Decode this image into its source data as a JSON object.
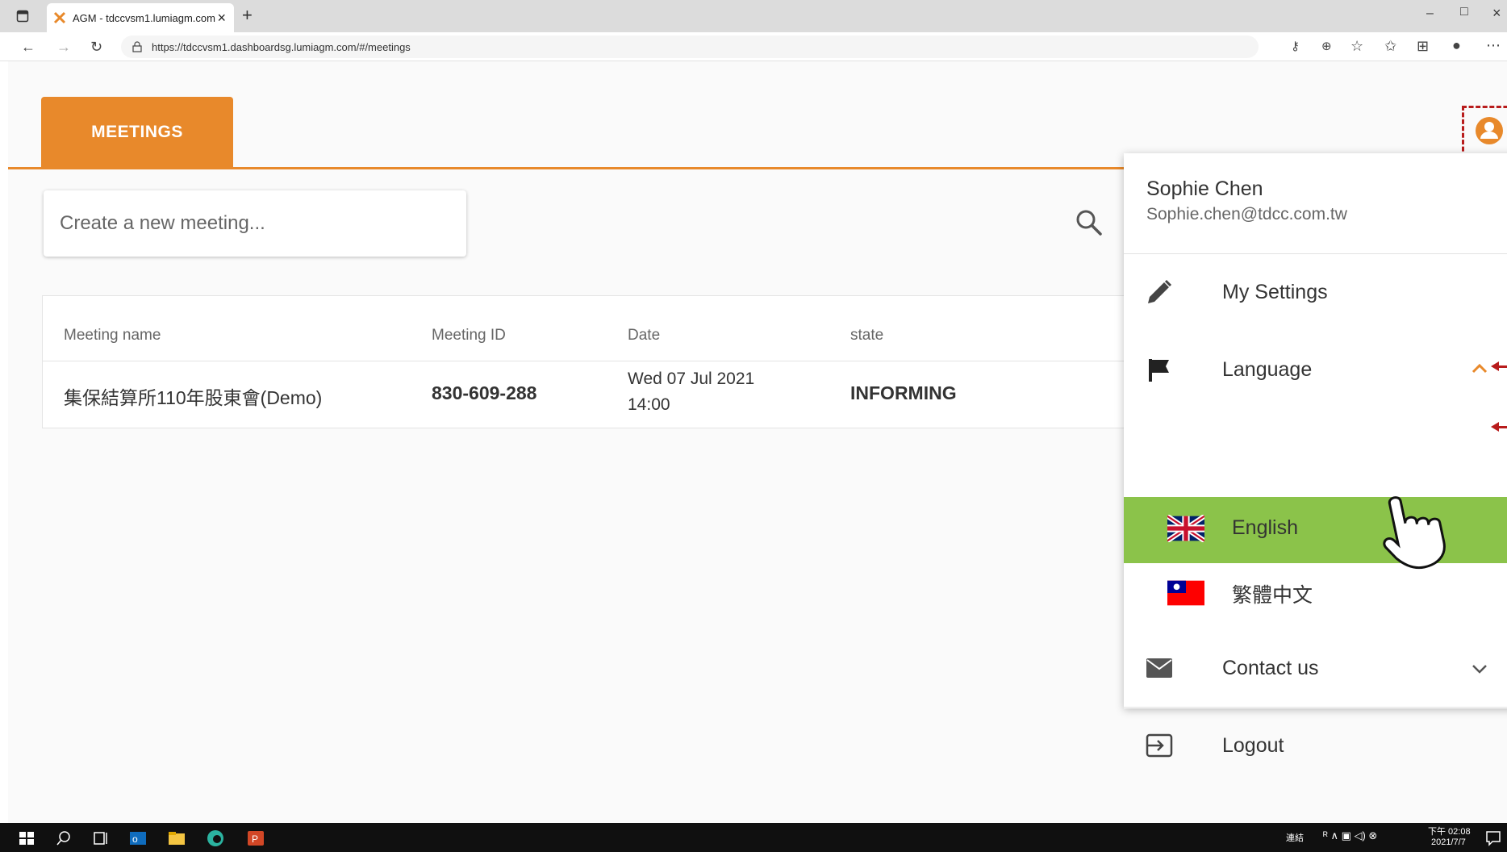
{
  "browser": {
    "tab_title": "AGM - tdccvsm1.lumiagm.com",
    "tab_close": "×",
    "new_tab": "+",
    "url": "https://tdccvsm1.dashboardsg.lumiagm.com/#/meetings",
    "window_controls": [
      "–",
      "□",
      "×"
    ]
  },
  "app": {
    "tab_label": "MEETINGS",
    "accent_color": "#e8892b",
    "create_placeholder": "Create a new meeting..."
  },
  "table": {
    "headers": [
      "Meeting name",
      "Meeting ID",
      "Date",
      "state"
    ],
    "rows": [
      {
        "name": "集保結算所110年股東會(Demo)",
        "id": "830-609-288",
        "date_line1": "Wed 07 Jul 2021",
        "date_line2": "14:00",
        "state": "INFORMING"
      }
    ]
  },
  "user_menu": {
    "name": "Sophie Chen",
    "email": "Sophie.chen@tdcc.com.tw",
    "items": {
      "settings": "My Settings",
      "language": "Language",
      "english": "English",
      "chinese": "繁體中文",
      "contact": "Contact us",
      "logout": "Logout"
    },
    "highlight_color": "#8bc34a"
  },
  "taskbar": {
    "lang": "連結",
    "time": "下午 02:08",
    "date": "2021/7/7"
  }
}
